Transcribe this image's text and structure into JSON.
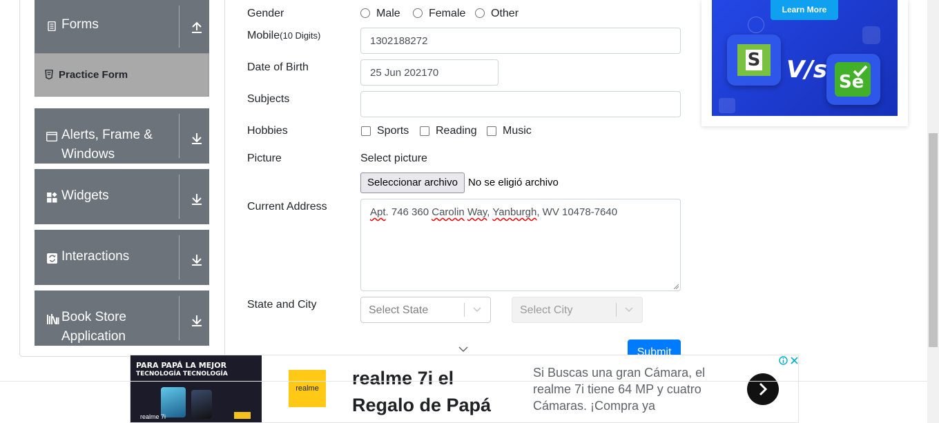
{
  "sidebar": {
    "forms_label": "Forms",
    "practice_form_label": "Practice Form",
    "alerts_label_line1": "Alerts, Frame &",
    "alerts_label_line2": "Windows",
    "widgets_label": "Widgets",
    "interactions_label": "Interactions",
    "bookstore_label_line1": "Book Store",
    "bookstore_label_line2": "Application"
  },
  "form": {
    "gender_label": "Gender",
    "gender_options": [
      "Male",
      "Female",
      "Other"
    ],
    "mobile_label": "Mobile",
    "mobile_hint": "(10 Digits)",
    "mobile_value": "1302188272",
    "dob_label": "Date of Birth",
    "dob_value": "25 Jun 202170",
    "subjects_label": "Subjects",
    "subjects_value": "",
    "hobbies_label": "Hobbies",
    "hobbies_options": [
      "Sports",
      "Reading",
      "Music"
    ],
    "picture_label": "Picture",
    "picture_prompt": "Select picture",
    "file_button": "Seleccionar archivo",
    "file_status": "No se eligió archivo",
    "address_label": "Current Address",
    "address_parts": [
      "Apt",
      ". 746 360 ",
      "Carolin",
      " ",
      "Way",
      ", ",
      "Yanburgh",
      ", WV 10478-7640"
    ],
    "state_city_label": "State and City",
    "state_placeholder": "Select State",
    "city_placeholder": "Select City",
    "submit_label": "Submit"
  },
  "banner_ad": {
    "badge": "Learn More"
  },
  "bottom_ad": {
    "image_headline_line1": "PARA PAPÁ LA MEJOR",
    "image_headline_line2": "TECNOLOGÍA TECNOLOGÍA",
    "image_brand": "realme 7i",
    "logo_text": "realme",
    "title_line1": "realme 7i el",
    "title_line2": "Regalo de Papá",
    "description": "Si Buscas una gran Cámara, el realme 7i tiene 64 MP y cuatro Cámaras. ¡Compra ya",
    "info_icon": "info-icon",
    "close_icon": "close-icon"
  },
  "colors": {
    "sidebar_group": "#6c737a",
    "sidebar_active": "#a9a9a9",
    "primary": "#007bff",
    "ad_blue": "#1a3dd6"
  }
}
